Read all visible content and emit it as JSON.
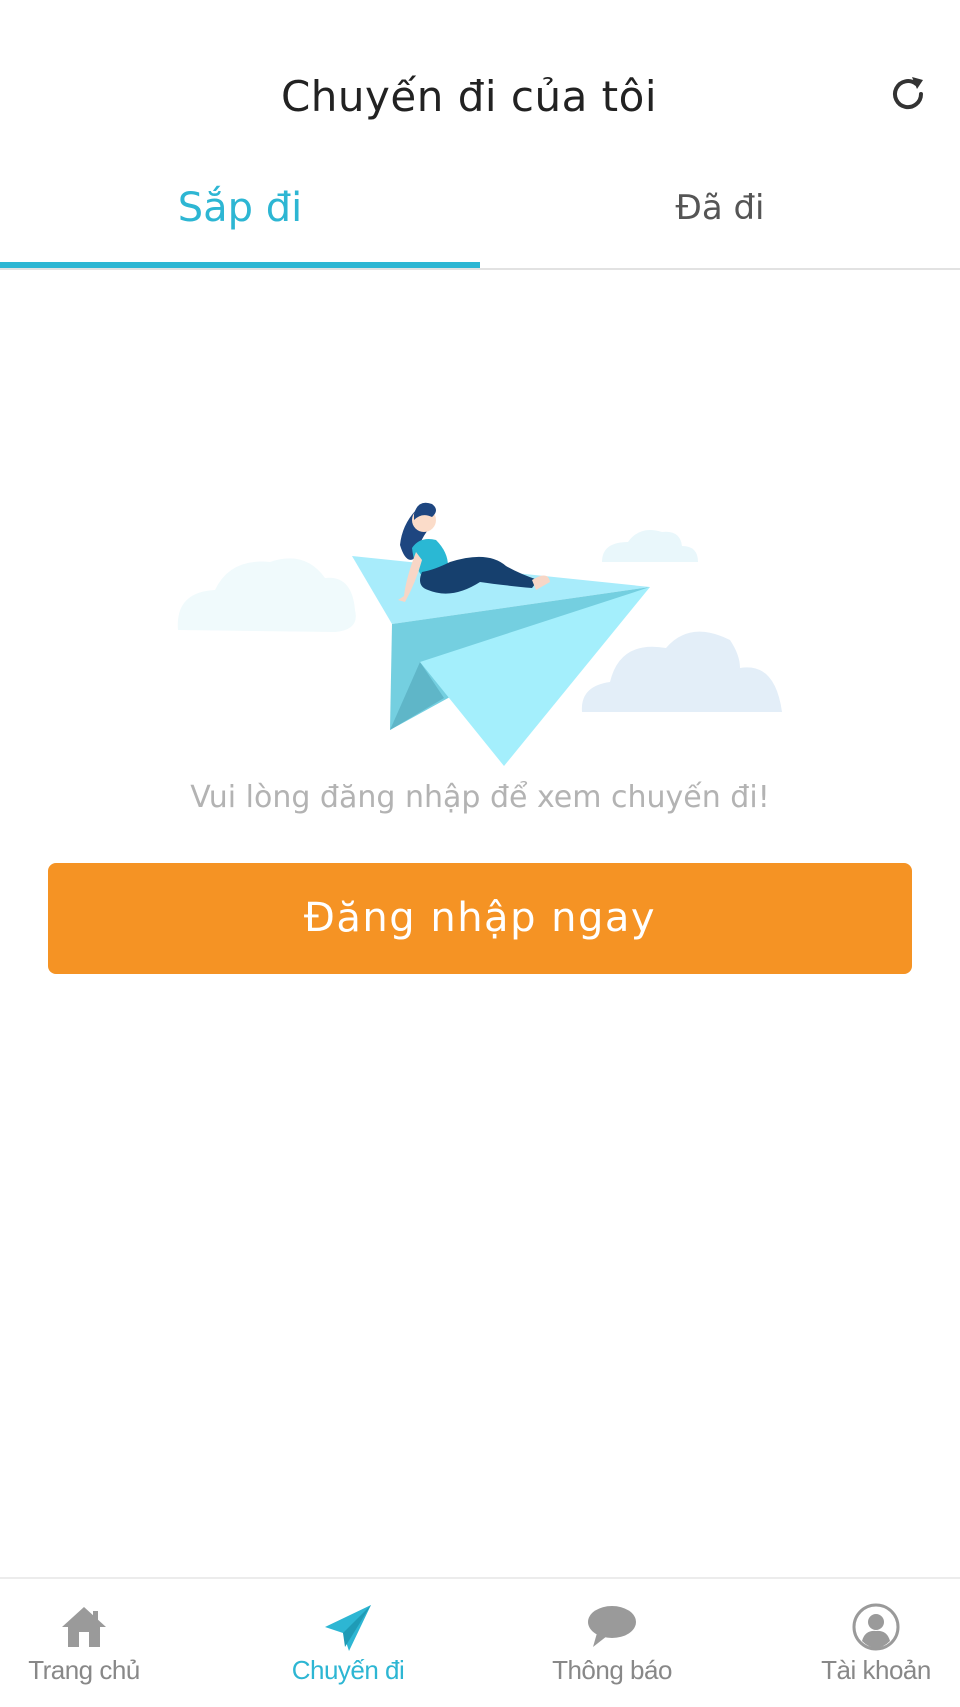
{
  "header": {
    "title": "Chuyến đi của tôi",
    "refresh_icon": "refresh-icon"
  },
  "tabs": [
    {
      "label": "Sắp đi",
      "active": true
    },
    {
      "label": "Đã đi",
      "active": false
    }
  ],
  "empty_state": {
    "illustration": "paper-plane-illustration",
    "message": "Vui lòng đăng nhập để xem chuyến đi!",
    "button_label": "Đăng nhập ngay"
  },
  "bottom_nav": {
    "items": [
      {
        "label": "Trang chủ",
        "icon": "home-icon",
        "active": false
      },
      {
        "label": "Chuyến đi",
        "icon": "paper-plane-icon",
        "active": true
      },
      {
        "label": "Thông báo",
        "icon": "chat-bubble-icon",
        "active": false
      },
      {
        "label": "Tài khoản",
        "icon": "user-icon",
        "active": false
      }
    ]
  },
  "colors": {
    "accent": "#2db6d3",
    "button": "#f59324",
    "inactive": "#888888",
    "message": "#b3b3b3"
  }
}
